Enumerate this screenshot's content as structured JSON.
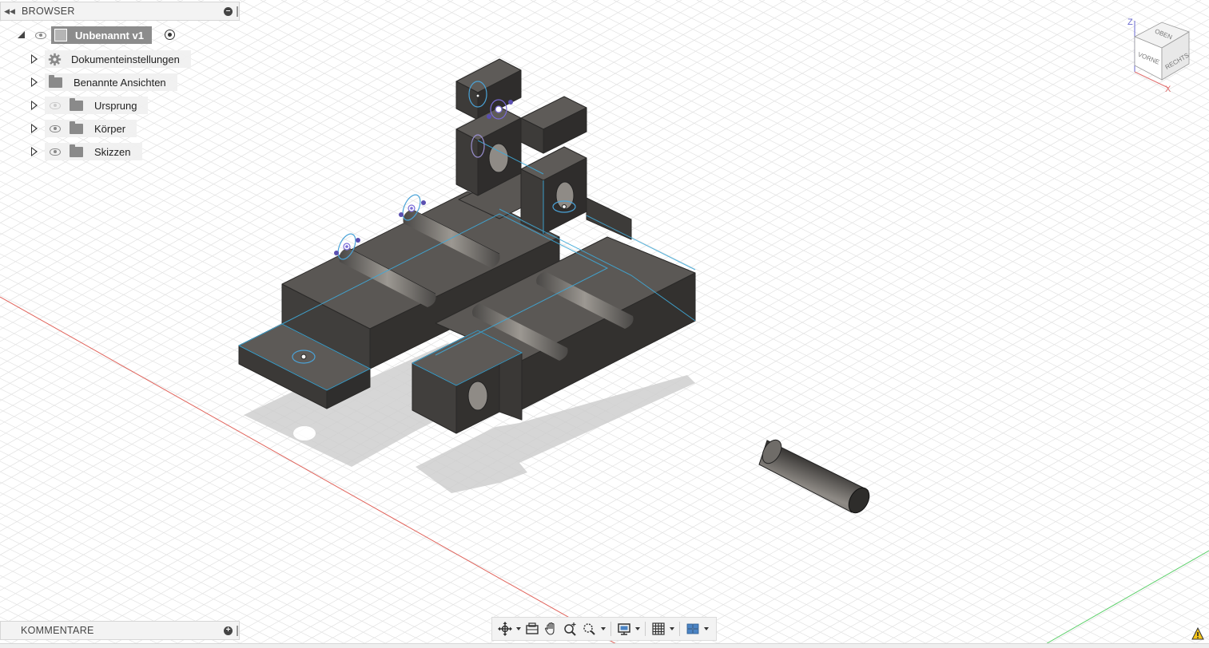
{
  "browser": {
    "title": "BROWSER",
    "root": {
      "label": "Unbenannt v1"
    },
    "items": [
      {
        "label": "Dokumenteinstellungen",
        "icon": "gear-icon",
        "eye": "none"
      },
      {
        "label": "Benannte Ansichten",
        "icon": "folder-icon",
        "eye": "none"
      },
      {
        "label": "Ursprung",
        "icon": "folder-icon",
        "eye": "hidden"
      },
      {
        "label": "Körper",
        "icon": "folder-icon",
        "eye": "visible"
      },
      {
        "label": "Skizzen",
        "icon": "folder-icon",
        "eye": "visible"
      }
    ]
  },
  "comments": {
    "title": "KOMMENTARE"
  },
  "viewcube": {
    "top": "OBEN",
    "front": "VORNE",
    "right": "RECHTS",
    "axis_z": "Z",
    "axis_x": "X"
  },
  "colors": {
    "body": "#5a5755",
    "edge_highlight": "#3fa9d8",
    "grid": "#e2e2e2",
    "axis_x": "#e0625a",
    "axis_y": "#5ccf6a",
    "sketch": "#7a6bd6"
  },
  "toolbar": {
    "tools": [
      "orbit-icon",
      "look-at-icon",
      "pan-icon",
      "zoom-icon",
      "zoom-window-icon",
      "display-settings-icon",
      "grid-settings-icon",
      "viewports-icon"
    ]
  }
}
